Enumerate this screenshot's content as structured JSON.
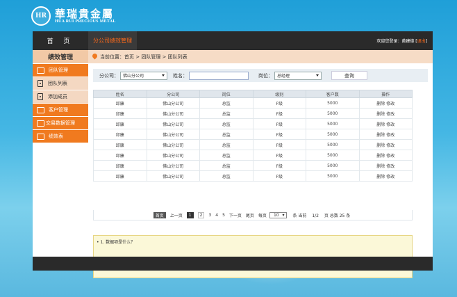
{
  "brand": {
    "name_cn": "華瑞貴金屬",
    "name_en": "HUA RUI PRECIOUS METAL",
    "mark": "HR"
  },
  "topbar": {
    "home_label": "首 页",
    "active_tab": "分公司绩效管理",
    "welcome": "欢迎您登录：黄建德",
    "logout": "退出"
  },
  "sidebar": {
    "title": "绩效管理",
    "items": [
      {
        "label": "团队管理",
        "style": "orange",
        "icon": "folder-icon"
      },
      {
        "label": "团队列表",
        "style": "light",
        "icon": "document-icon"
      },
      {
        "label": "添加成员",
        "style": "light",
        "icon": "document-icon"
      },
      {
        "label": "客户管理",
        "style": "orange",
        "icon": "folder-icon"
      },
      {
        "label": "交易数据管理",
        "style": "orange",
        "icon": "folder-icon"
      },
      {
        "label": "绩效表",
        "style": "orange",
        "icon": "folder-icon"
      }
    ]
  },
  "breadcrumb": {
    "text": "当前位置：首页 > 团队管理 > 团队列表"
  },
  "filter": {
    "branch_label": "分公司：",
    "branch_value": "佛山分公司",
    "name_label": "姓名：",
    "name_value": "",
    "position_label": "岗位：",
    "position_value": "总经理",
    "query_button": "查询"
  },
  "table": {
    "columns": [
      "姓名",
      "分公司",
      "岗位",
      "级别",
      "客户数",
      "操作"
    ],
    "rows": [
      [
        "邱康",
        "佛山分公司",
        "总监",
        "F级",
        "5000",
        "删除 修改"
      ],
      [
        "邱康",
        "佛山分公司",
        "总监",
        "F级",
        "5000",
        "删除 修改"
      ],
      [
        "邱康",
        "佛山分公司",
        "总监",
        "F级",
        "5000",
        "删除 修改"
      ],
      [
        "邱康",
        "佛山分公司",
        "总监",
        "F级",
        "5000",
        "删除 修改"
      ],
      [
        "邱康",
        "佛山分公司",
        "总监",
        "F级",
        "5000",
        "删除 修改"
      ],
      [
        "邱康",
        "佛山分公司",
        "总监",
        "F级",
        "5000",
        "删除 修改"
      ],
      [
        "邱康",
        "佛山分公司",
        "总监",
        "F级",
        "5000",
        "删除 修改"
      ],
      [
        "邱康",
        "佛山分公司",
        "总监",
        "F级",
        "5000",
        "删除 修改"
      ]
    ]
  },
  "pager": {
    "first": "首页",
    "prev": "上一页",
    "pages": [
      "1",
      "2",
      "3",
      "4",
      "5"
    ],
    "current": "1",
    "next": "下一页",
    "last": "尾页",
    "per_page_label": "每页",
    "per_page_value": "10",
    "summary_prefix": "条 当前",
    "summary_page": "1/2",
    "summary_suffix": "页 总数 25 条"
  },
  "notice": {
    "text": "• 1. 数据项是什么？"
  },
  "colors": {
    "accent": "#f07a1f",
    "topbar": "#2a2a2a",
    "active_tab_text": "#ff6a1a"
  }
}
